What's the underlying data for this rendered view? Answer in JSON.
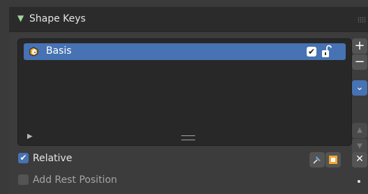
{
  "panel": {
    "title": "Shape Keys"
  },
  "shape_keys": [
    {
      "name": "Basis",
      "enabled": true,
      "selected": true
    }
  ],
  "side_buttons": {
    "add": "+",
    "remove": "−",
    "specials": "⌄",
    "move_up": "▲",
    "move_down": "▼",
    "clear": "✕"
  },
  "options": {
    "relative_label": "Relative",
    "relative_checked": true,
    "add_rest_position_label": "Add Rest Position",
    "add_rest_position_checked": false
  },
  "colors": {
    "accent": "#4772b3",
    "panel_bg": "#3c3c3c",
    "header_bg": "#2b2b2b",
    "list_bg": "#282828"
  }
}
